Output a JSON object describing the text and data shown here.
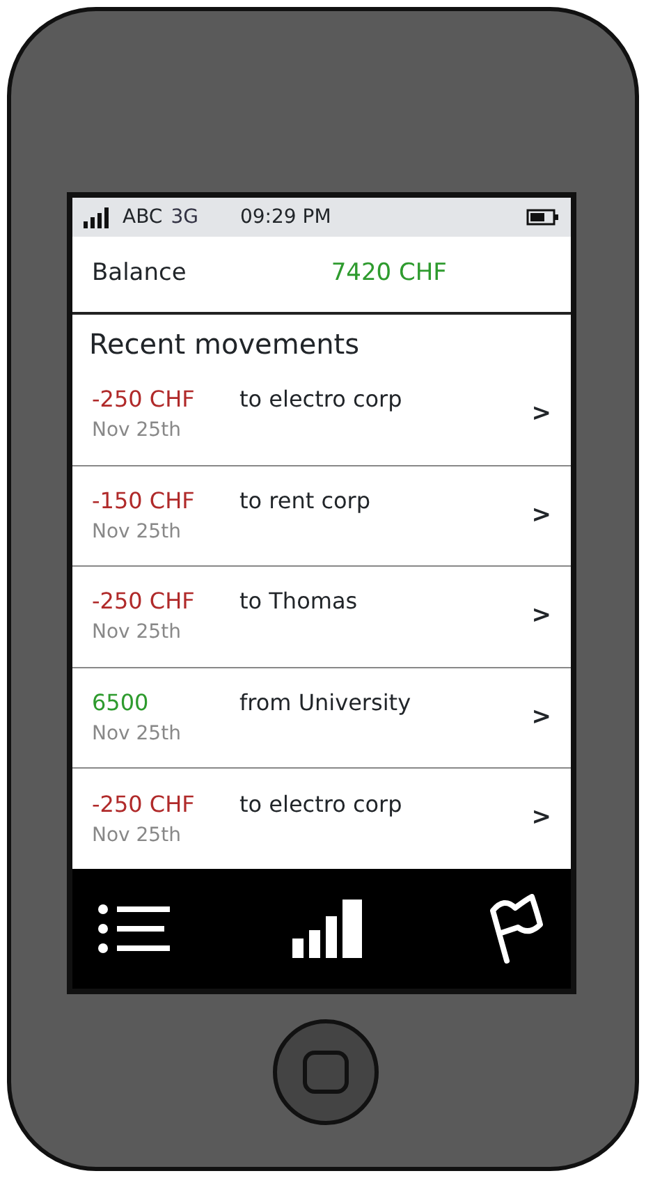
{
  "status_bar": {
    "carrier": "ABC",
    "network": "3G",
    "time": "09:29 PM"
  },
  "balance": {
    "label": "Balance",
    "value": "7420 CHF"
  },
  "section_title": "Recent movements",
  "movements": [
    {
      "amount": "-250 CHF",
      "kind": "debit",
      "description": "to electro corp",
      "date": "Nov 25th",
      "chevron": ">"
    },
    {
      "amount": "-150 CHF",
      "kind": "debit",
      "description": "to rent corp",
      "date": "Nov 25th",
      "chevron": ">"
    },
    {
      "amount": "-250 CHF",
      "kind": "debit",
      "description": "to Thomas",
      "date": "Nov 25th",
      "chevron": ">"
    },
    {
      "amount": "6500",
      "kind": "credit",
      "description": "from University",
      "date": "Nov 25th",
      "chevron": ">"
    },
    {
      "amount": "-250 CHF",
      "kind": "debit",
      "description": "to electro corp",
      "date": "Nov 25th",
      "chevron": ">"
    }
  ]
}
